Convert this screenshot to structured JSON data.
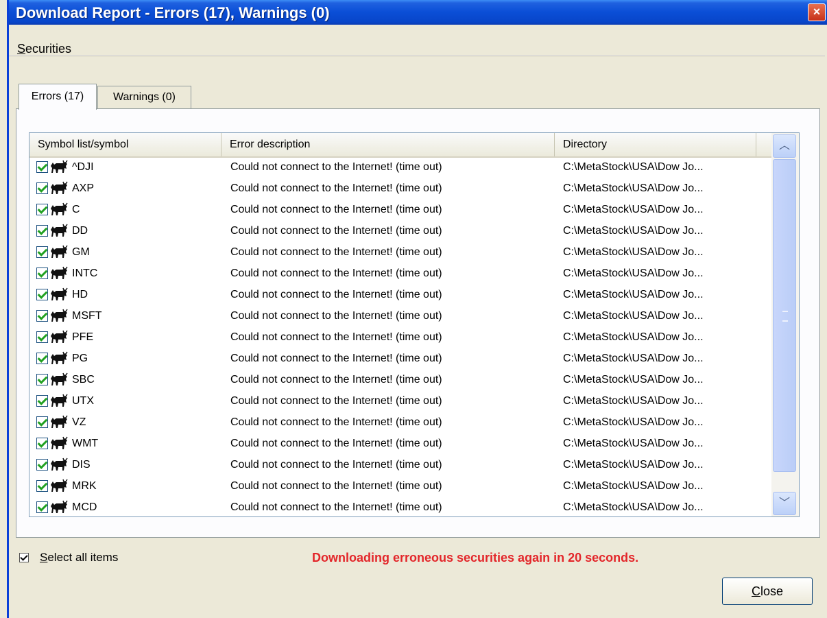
{
  "window": {
    "title": "Download Report - Errors (17), Warnings (0)",
    "close_glyph": "×"
  },
  "menubar": {
    "securities_mnemonic": "S",
    "securities_rest": "ecurities"
  },
  "tabs": [
    {
      "label": "Errors (17)",
      "active": true
    },
    {
      "label": "Warnings (0)",
      "active": false
    }
  ],
  "table": {
    "columns": [
      "Symbol list/symbol",
      "Error description",
      "Directory"
    ],
    "rows": [
      {
        "symbol": "^DJI",
        "error": "Could not connect to the Internet! (time out)",
        "directory": "C:\\MetaStock\\USA\\Dow Jo...",
        "checked": true
      },
      {
        "symbol": "AXP",
        "error": "Could not connect to the Internet! (time out)",
        "directory": "C:\\MetaStock\\USA\\Dow Jo...",
        "checked": true
      },
      {
        "symbol": "C",
        "error": "Could not connect to the Internet! (time out)",
        "directory": "C:\\MetaStock\\USA\\Dow Jo...",
        "checked": true
      },
      {
        "symbol": "DD",
        "error": "Could not connect to the Internet! (time out)",
        "directory": "C:\\MetaStock\\USA\\Dow Jo...",
        "checked": true
      },
      {
        "symbol": "GM",
        "error": "Could not connect to the Internet! (time out)",
        "directory": "C:\\MetaStock\\USA\\Dow Jo...",
        "checked": true
      },
      {
        "symbol": "INTC",
        "error": "Could not connect to the Internet! (time out)",
        "directory": "C:\\MetaStock\\USA\\Dow Jo...",
        "checked": true
      },
      {
        "symbol": "HD",
        "error": "Could not connect to the Internet! (time out)",
        "directory": "C:\\MetaStock\\USA\\Dow Jo...",
        "checked": true
      },
      {
        "symbol": "MSFT",
        "error": "Could not connect to the Internet! (time out)",
        "directory": "C:\\MetaStock\\USA\\Dow Jo...",
        "checked": true
      },
      {
        "symbol": "PFE",
        "error": "Could not connect to the Internet! (time out)",
        "directory": "C:\\MetaStock\\USA\\Dow Jo...",
        "checked": true
      },
      {
        "symbol": "PG",
        "error": "Could not connect to the Internet! (time out)",
        "directory": "C:\\MetaStock\\USA\\Dow Jo...",
        "checked": true
      },
      {
        "symbol": "SBC",
        "error": "Could not connect to the Internet! (time out)",
        "directory": "C:\\MetaStock\\USA\\Dow Jo...",
        "checked": true
      },
      {
        "symbol": "UTX",
        "error": "Could not connect to the Internet! (time out)",
        "directory": "C:\\MetaStock\\USA\\Dow Jo...",
        "checked": true
      },
      {
        "symbol": "VZ",
        "error": "Could not connect to the Internet! (time out)",
        "directory": "C:\\MetaStock\\USA\\Dow Jo...",
        "checked": true
      },
      {
        "symbol": "WMT",
        "error": "Could not connect to the Internet! (time out)",
        "directory": "C:\\MetaStock\\USA\\Dow Jo...",
        "checked": true
      },
      {
        "symbol": "DIS",
        "error": "Could not connect to the Internet! (time out)",
        "directory": "C:\\MetaStock\\USA\\Dow Jo...",
        "checked": true
      },
      {
        "symbol": "MRK",
        "error": "Could not connect to the Internet! (time out)",
        "directory": "C:\\MetaStock\\USA\\Dow Jo...",
        "checked": true
      },
      {
        "symbol": "MCD",
        "error": "Could not connect to the Internet! (time out)",
        "directory": "C:\\MetaStock\\USA\\Dow Jo...",
        "checked": true
      }
    ],
    "row_icon": "bull-icon",
    "scroll_up_glyph": "︿",
    "scroll_down_glyph": "﹀"
  },
  "footer": {
    "select_all_mnemonic": "S",
    "select_all_rest": "elect all items",
    "select_all_checked": true,
    "status_message": "Downloading erroneous securities again in 20 seconds.",
    "close_mnemonic": "C",
    "close_rest": "lose"
  },
  "colors": {
    "title_bar": "#0a4ed6",
    "status_message": "#e3262a",
    "window_bg": "#ece9d8"
  }
}
